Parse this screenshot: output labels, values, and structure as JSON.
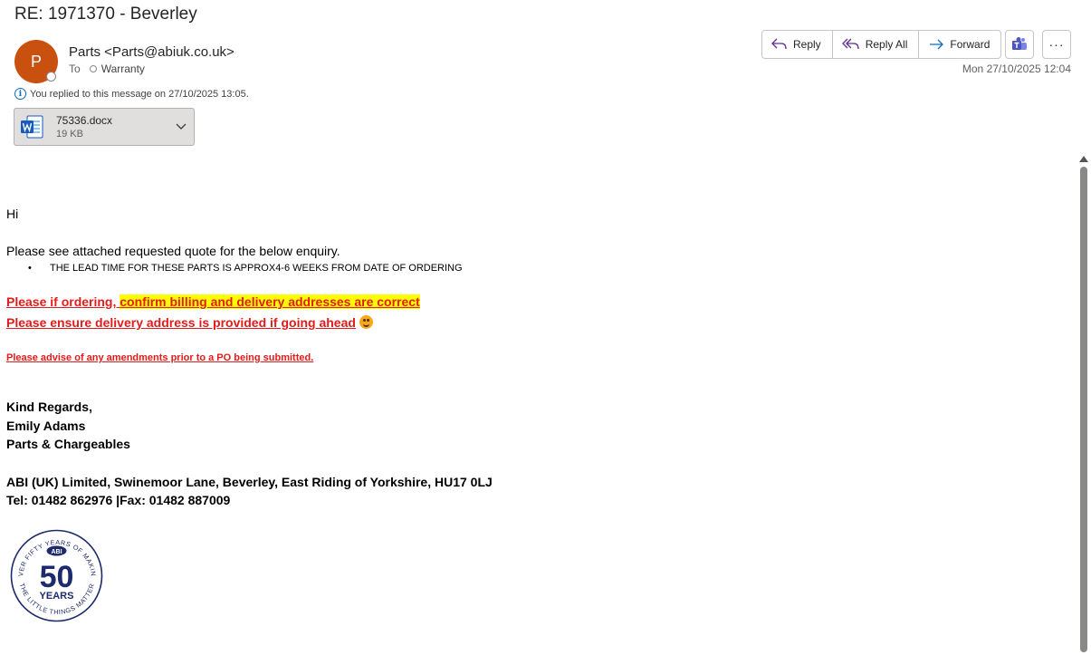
{
  "subject": "RE: 1971370 - Beverley",
  "sender": {
    "initial": "P",
    "display": "Parts <Parts@abiuk.co.uk>"
  },
  "recipients": {
    "label": "To",
    "name": "Warranty"
  },
  "actions": {
    "reply": "Reply",
    "reply_all": "Reply All",
    "forward": "Forward",
    "more": "···"
  },
  "date": "Mon 27/10/2025 12:04",
  "info": "You replied to this message on 27/10/2025 13:05.",
  "attachment": {
    "name": "75336.docx",
    "size": "19 KB"
  },
  "body": {
    "greeting": "Hi",
    "intro": "Please see attached requested quote for the below enquiry.",
    "bullet": "THE LEAD TIME FOR THESE PARTS IS APPROX4-6 WEEKS FROM DATE OF ORDERING",
    "red1_a": "Please if ordering, ",
    "red1_b": "confirm billing and delivery addresses are correct",
    "red2": "Please ensure delivery address is provided if going ahead",
    "red3": "Please advise of any amendments prior to a PO being submitted.",
    "sign_1": "Kind Regards,",
    "sign_2": "Emily Adams",
    "sign_3": "Parts & Chargeables",
    "address": "ABI (UK) Limited, Swinemoor Lane, Beverley, East Riding of Yorkshire, HU17 0LJ",
    "phone": "Tel: 01482 862976 |Fax: 01482 887009"
  },
  "logo": {
    "top_text": "OVER FIFTY YEARS OF MAKING",
    "bottom_text": "THE LITTLE THINGS MATTER",
    "badge": "ABI",
    "number": "50",
    "word": "YEARS"
  },
  "colors": {
    "avatar": "#ca5010",
    "accent": "#0f6cbd",
    "red": "#e31b1b",
    "highlight": "#ffff00",
    "logo_navy": "#1d2a6b",
    "word_blue": "#185abd"
  }
}
